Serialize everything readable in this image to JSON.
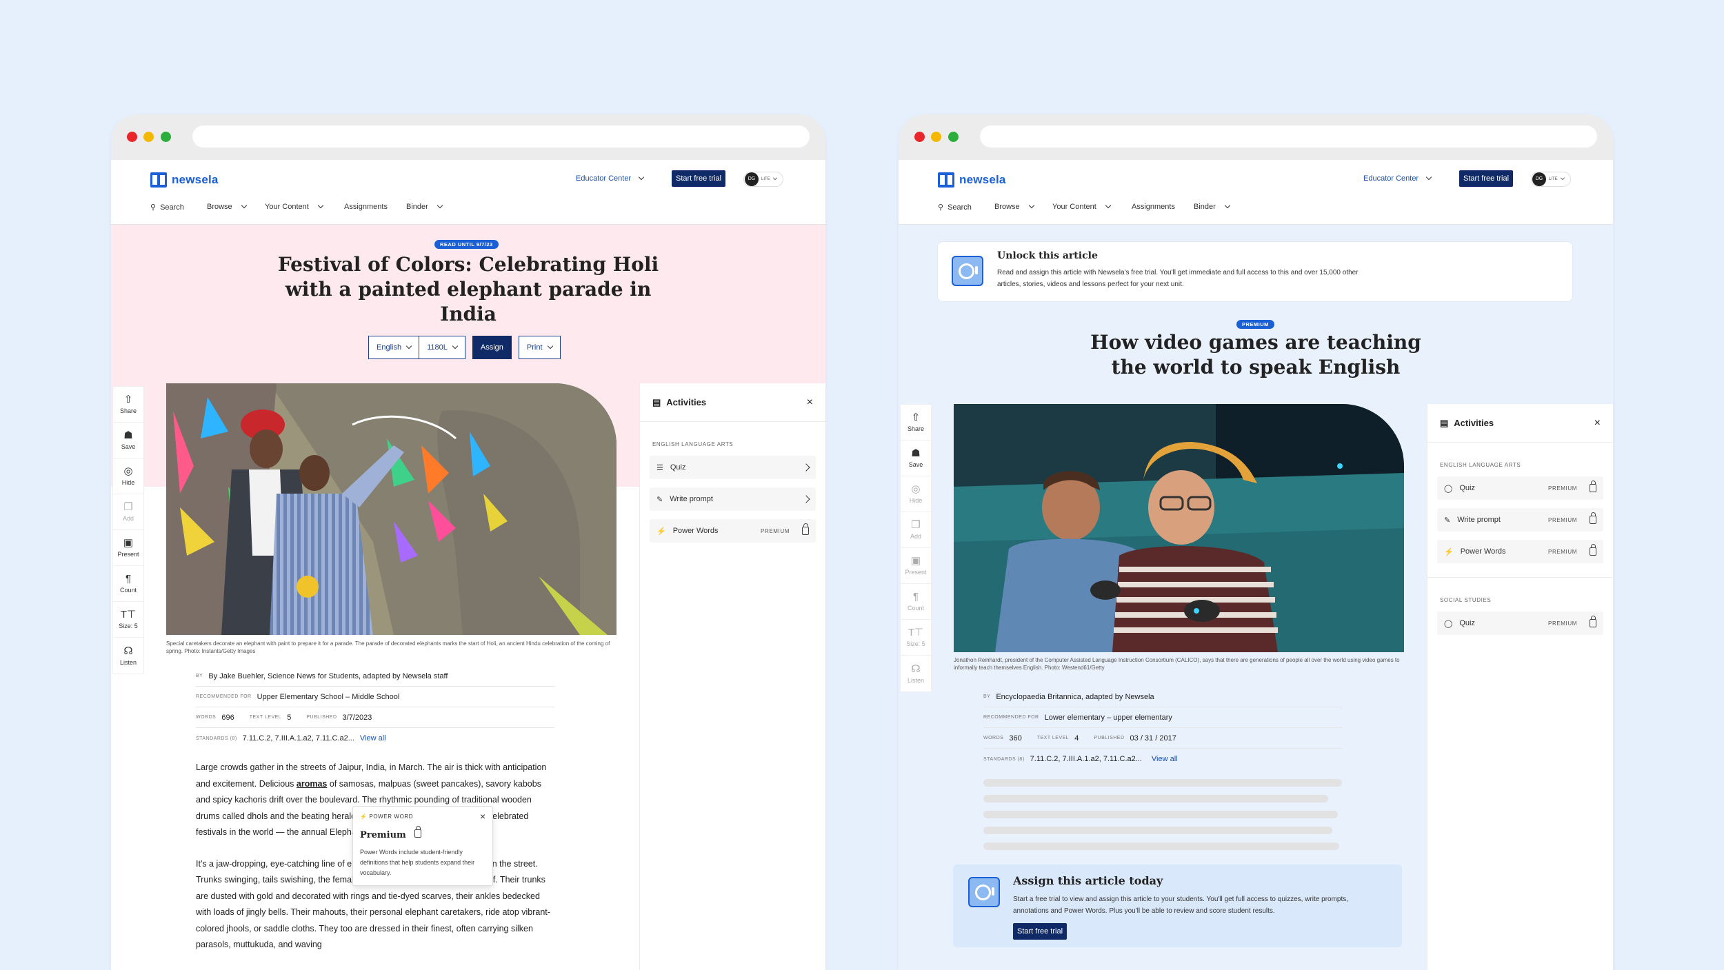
{
  "colors": {
    "page_bg": "#e6effc",
    "brand": "#1a5fd6",
    "navy": "#0f2a66",
    "pink_hero": "#fde9ee",
    "blue_hero": "#e9f1fc"
  },
  "common": {
    "logo": "newsela",
    "educator_center": "Educator Center",
    "start_trial": "Start free trial",
    "avatar_initials": "DG",
    "avatar_tag": "LITE",
    "nav": [
      "Search",
      "Browse",
      "Your Content",
      "Assignments",
      "Binder"
    ],
    "tools": [
      "Share",
      "Save",
      "Hide",
      "Add",
      "Present",
      "Count",
      "Size: 5",
      "Listen"
    ],
    "tools_right": [
      "Share",
      "Save",
      "Hide",
      "Add",
      "Present",
      "Count",
      "Size: 5",
      "Listen"
    ],
    "activities_title": "Activities",
    "premium": "PREMIUM"
  },
  "left": {
    "badge": "READ UNTIL 9/7/23",
    "title": "Festival of Colors: Celebrating Holi with a painted elephant parade in India",
    "controls": {
      "language": "English",
      "level": "1180L",
      "assign": "Assign",
      "print": "Print"
    },
    "caption": "Special caretakers decorate an elephant with paint to prepare it for a parade. The parade of decorated elephants marks the start of Holi, an ancient Hindu celebration of the coming of spring. Photo: Instants/Getty Images",
    "meta": {
      "by_label": "BY",
      "by": "By Jake Buehler, Science News for Students, adapted by Newsela staff",
      "rec_label": "RECOMMENDED FOR",
      "rec": "Upper Elementary School – Middle School",
      "words_label": "WORDS",
      "words": "696",
      "level_label": "TEXT LEVEL",
      "level": "5",
      "pub_label": "PUBLISHED",
      "pub": "3/7/2023",
      "std_label": "STANDARDS (8)",
      "std": "7.11.C.2, 7.III.A.1.a2, 7.11.C.a2...",
      "view_all": "View all"
    },
    "para1_a": "Large crowds gather in the streets of Jaipur, India, in March. The air is thick with anticipation and excitement. Delicious ",
    "para1_word": "aromas",
    "para1_b": " of samosas, malpuas (sweet pancakes), savory kabobs and spicy kachoris drift over the boulevard. The rhythmic pounding of traditional wooden drums called dhols and the beating heralds the beginning of one of the most celebrated festivals in the world — the annual Elephant Parade that marks",
    "para2": "It's a jaw-dropping, eye-catching line of elephants moving canvases stroll down the street. Trunks swinging, tails swishing, the female pachyderms proudly strut their stuff. Their trunks are dusted with gold and decorated with rings and tie-dyed scarves, their ankles bedecked with loads of jingly bells. Their mahouts, their personal elephant caretakers, ride atop vibrant-colored jhools, or saddle cloths. They too are dressed in their finest, often carrying silken parasols, muttukuda, and waving",
    "popover": {
      "label": "POWER WORD",
      "title": "Premium",
      "desc": "Power Words include student-friendly definitions that help students expand their vocabulary."
    },
    "activities": {
      "section": "ENGLISH LANGUAGE ARTS",
      "items": [
        {
          "label": "Quiz"
        },
        {
          "label": "Write prompt"
        },
        {
          "label": "Power Words",
          "premium": "PREMIUM"
        }
      ]
    }
  },
  "right": {
    "unlock_title": "Unlock this article",
    "unlock_text": "Read and assign this article with Newsela's free trial. You'll get immediate and full access to this and over 15,000 other articles, stories, videos and lessons perfect for your next unit.",
    "badge": "PREMIUM",
    "title": "How video games are teaching the world to speak English",
    "caption": "Jonathon Reinhardt, president of the Computer Assisted Language Instruction Consortium (CALICO), says that there are generations of people all over the world using video games to informally teach themselves English. Photo: Westend61/Getty",
    "meta": {
      "by_label": "BY",
      "by": "Encyclopaedia Britannica, adapted by Newsela",
      "rec_label": "RECOMMENDED FOR",
      "rec": "Lower elementary – upper elementary",
      "words_label": "WORDS",
      "words": "360",
      "level_label": "TEXT LEVEL",
      "level": "4",
      "pub_label": "PUBLISHED",
      "pub": "03 / 31 / 2017",
      "std_label": "STANDARDS (8)",
      "std": "7.11.C.2, 7.III.A.1.a2, 7.11.C.a2...",
      "view_all": "View all"
    },
    "cta": {
      "title": "Assign this article today",
      "text": "Start a free trial to view and assign this article to your students. You'll get full access to quizzes, write prompts, annotations and Power Words. Plus you'll be able to review and score student results.",
      "button": "Start free trial"
    },
    "activities": {
      "section1": "ENGLISH LANGUAGE ARTS",
      "items1": [
        {
          "label": "Quiz"
        },
        {
          "label": "Write prompt"
        },
        {
          "label": "Power Words"
        }
      ],
      "section2": "SOCIAL STUDIES",
      "items2": [
        {
          "label": "Quiz"
        }
      ]
    }
  }
}
